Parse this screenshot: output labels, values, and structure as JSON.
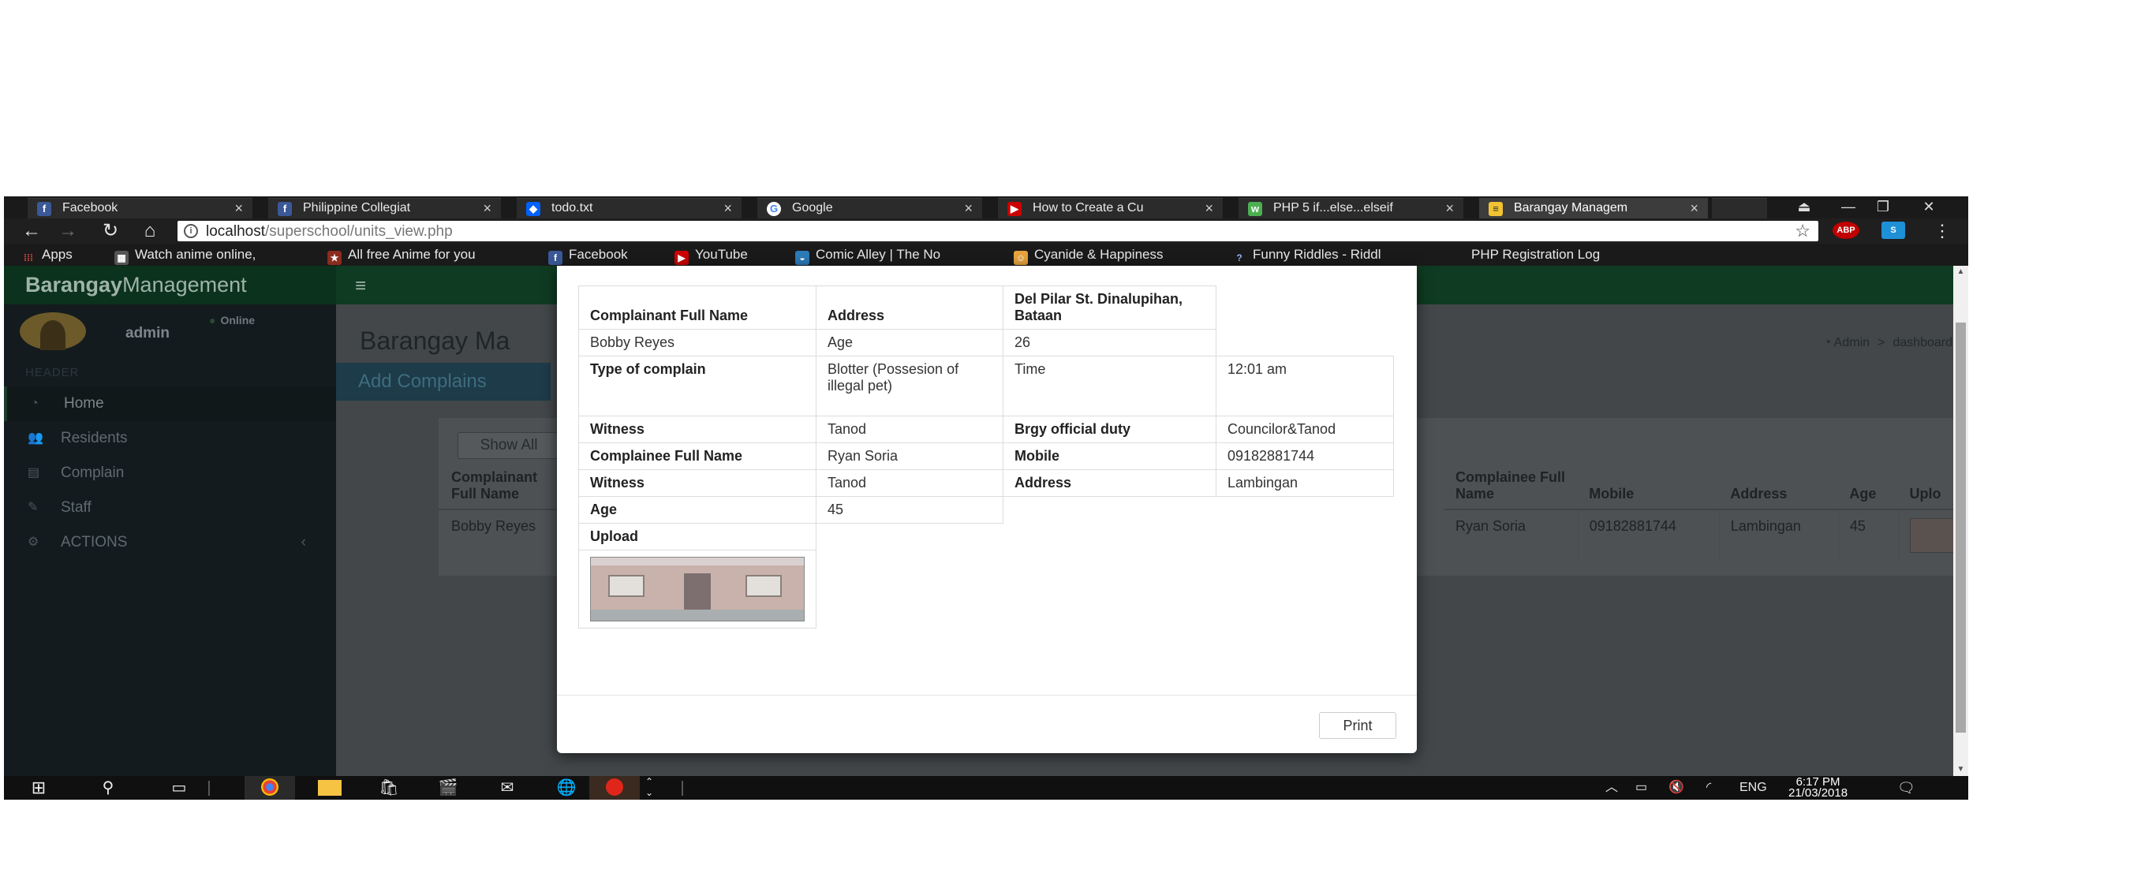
{
  "browser": {
    "tabs": [
      {
        "label": "Facebook",
        "favicon": "facebook-icon"
      },
      {
        "label": "Philippine Collegiat",
        "favicon": "facebook-icon"
      },
      {
        "label": "todo.txt",
        "favicon": "dropbox-icon"
      },
      {
        "label": "Google",
        "favicon": "google-icon"
      },
      {
        "label": "How to Create a Cu",
        "favicon": "youtube-icon"
      },
      {
        "label": "PHP 5 if...else...elseif",
        "favicon": "w3schools-icon"
      },
      {
        "label": "Barangay Managem",
        "favicon": "page-icon"
      }
    ],
    "url": {
      "host": "localhost",
      "path": "/superschool/units_view.php"
    },
    "bookmarks": [
      {
        "label": "Apps",
        "icon": "apps-grid-icon"
      },
      {
        "label": "Watch anime online,",
        "icon": "anime-site-icon"
      },
      {
        "label": "All free Anime for you",
        "icon": "anime-free-icon"
      },
      {
        "label": "Facebook",
        "icon": "facebook-icon"
      },
      {
        "label": "YouTube",
        "icon": "youtube-icon"
      },
      {
        "label": "Comic Alley | The No",
        "icon": "comic-alley-icon"
      },
      {
        "label": "Cyanide & Happiness",
        "icon": "cyanide-icon"
      },
      {
        "label": "Funny Riddles - Riddl",
        "icon": "question-icon"
      },
      {
        "label": "PHP Registration Log",
        "icon": "none"
      }
    ],
    "extensions": {
      "abp": "ABP",
      "skype": "S"
    }
  },
  "app": {
    "brand_bold": "Barangay",
    "brand_rest": "Management",
    "user": {
      "name": "admin",
      "status": "Online"
    },
    "sidebar": {
      "header": "HEADER",
      "items": [
        {
          "label": "Home",
          "icon": "dashboard-icon"
        },
        {
          "label": "Residents",
          "icon": "users-icon"
        },
        {
          "label": "Complain",
          "icon": "list-icon"
        },
        {
          "label": "Staff",
          "icon": "pencil-icon"
        },
        {
          "label": "ACTIONS",
          "icon": "gears-icon"
        }
      ]
    },
    "page_title": "Barangay Ma",
    "breadcrumb": {
      "first": "Admin",
      "separator": ">",
      "second": "dashboard"
    },
    "add_tab": "Add Complains",
    "show_all": "Show All",
    "table_left": {
      "headers": [
        "Complainant Full Name"
      ],
      "rows": [
        [
          "Bobby Reyes"
        ]
      ]
    },
    "table_right": {
      "headers": [
        "Complainee Full Name",
        "Mobile",
        "Address",
        "Age",
        "Uplo"
      ],
      "rows": [
        [
          "Ryan Soria",
          "09182881744",
          "Lambingan",
          "45"
        ]
      ]
    }
  },
  "modal": {
    "rows": [
      [
        "Complainant Full Name",
        "Address",
        "Del Pilar St. Dinalupihan, Bataan"
      ],
      [
        "Bobby Reyes",
        "Age",
        "26"
      ],
      [
        "Type of complain",
        "Blotter (Possesion of illegal pet)",
        "Time",
        "12:01 am"
      ],
      [
        "Witness",
        "Tanod",
        "Brgy official duty",
        "Councilor&Tanod"
      ],
      [
        "Complainee Full Name",
        "Ryan Soria",
        "Mobile",
        "09182881744"
      ],
      [
        "Witness",
        "Tanod",
        "Address",
        "Lambingan"
      ],
      [
        "Age",
        "45"
      ],
      [
        "Upload"
      ]
    ],
    "print_label": "Print"
  },
  "taskbar": {
    "language": "ENG",
    "time": "6:17 PM",
    "date": "21/03/2018"
  }
}
